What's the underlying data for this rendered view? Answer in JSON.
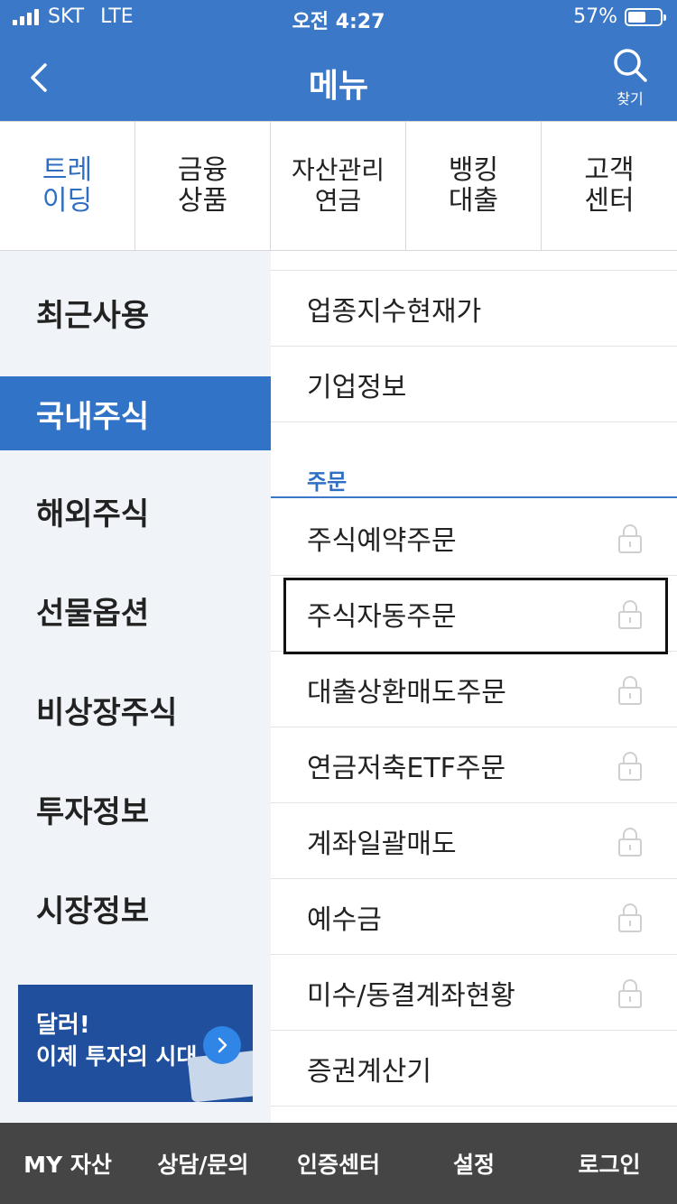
{
  "status_bar": {
    "carrier": "SKT",
    "network": "LTE",
    "time": "오전 4:27",
    "battery_percent": "57%",
    "battery_level": 0.57
  },
  "nav": {
    "title": "메뉴",
    "search_label": "찾기",
    "back_icon": "chevron-left-icon",
    "search_icon": "search-icon"
  },
  "categories": [
    {
      "label": "트레\n이딩",
      "active": true
    },
    {
      "label": "금융\n상품",
      "active": false
    },
    {
      "label": "자산관리\n연금",
      "active": false
    },
    {
      "label": "뱅킹\n대출",
      "active": false
    },
    {
      "label": "고객\n센터",
      "active": false
    }
  ],
  "side_menu": {
    "items": [
      {
        "label": "최근사용",
        "active": false
      },
      {
        "label": "국내주식",
        "active": true
      },
      {
        "label": "해외주식",
        "active": false
      },
      {
        "label": "선물옵션",
        "active": false
      },
      {
        "label": "비상장주식",
        "active": false
      },
      {
        "label": "투자정보",
        "active": false
      },
      {
        "label": "시장정보",
        "active": false
      }
    ],
    "banner": {
      "line1": "달러!",
      "line2": "이제 투자의 시대"
    }
  },
  "menu_list": {
    "top_items": [
      {
        "label": "업종지수현재가",
        "locked": false
      },
      {
        "label": "기업정보",
        "locked": false
      }
    ],
    "section_title": "주문",
    "order_items": [
      {
        "label": "주식예약주문",
        "locked": true
      },
      {
        "label": "주식자동주문",
        "locked": true
      },
      {
        "label": "대출상환매도주문",
        "locked": true
      },
      {
        "label": "연금저축ETF주문",
        "locked": true
      },
      {
        "label": "계좌일괄매도",
        "locked": true
      },
      {
        "label": "예수금",
        "locked": true
      },
      {
        "label": "미수/동결계좌현황",
        "locked": true
      },
      {
        "label": "증권계산기",
        "locked": false
      }
    ]
  },
  "tab_bar": {
    "items": [
      "MY 자산",
      "상담/문의",
      "인증센터",
      "설정",
      "로그인"
    ]
  },
  "colors": {
    "primary": "#3b78c8",
    "active_side": "#3173c6",
    "side_bg": "#f0f4f8",
    "tabbar_bg": "#454545",
    "accent_text": "#2f6fc3"
  }
}
